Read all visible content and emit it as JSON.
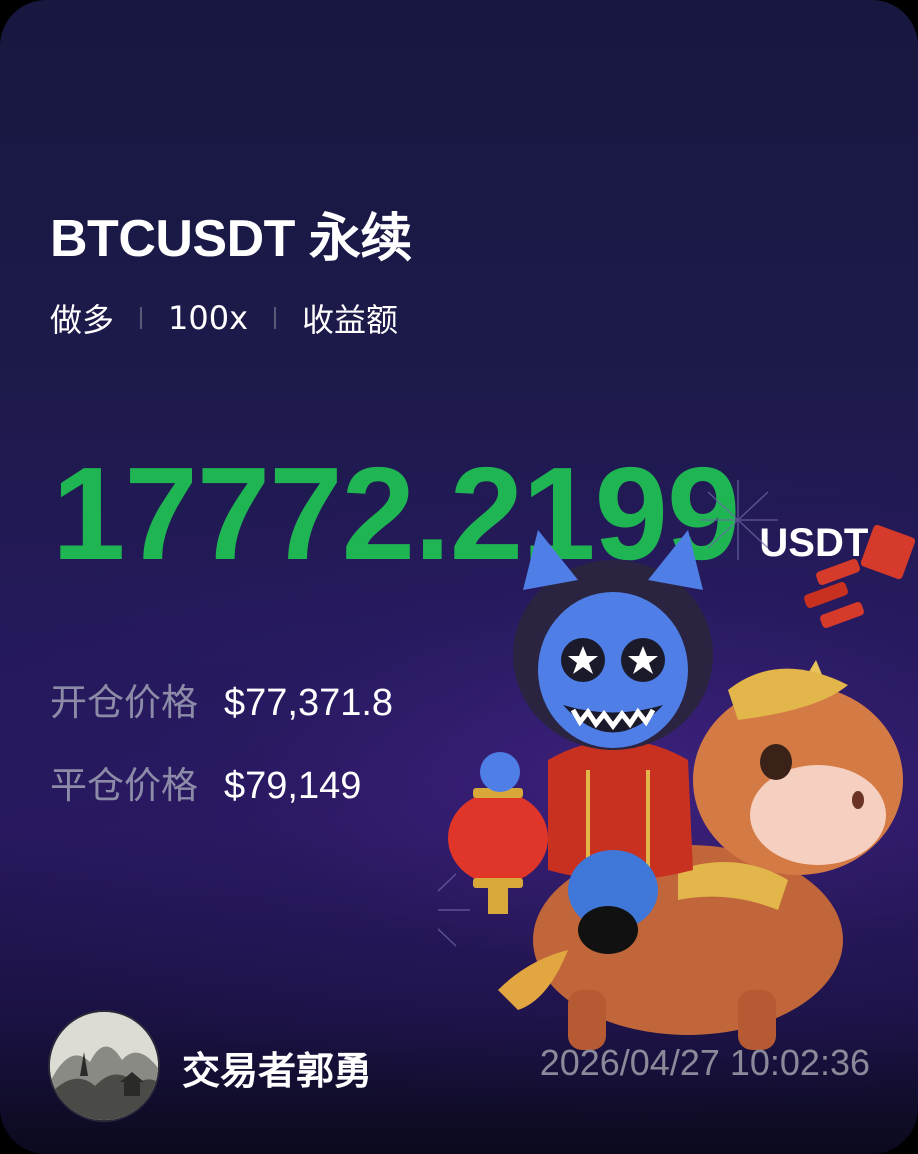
{
  "header": {
    "symbol": "BTCUSDT",
    "contract_type": "永续"
  },
  "position": {
    "side": "做多",
    "leverage": "100x",
    "metric_label": "收益额"
  },
  "pnl": {
    "value": "17772.2199",
    "unit": "USDT"
  },
  "prices": {
    "open_label": "开仓价格",
    "open_value": "$77,371.8",
    "close_label": "平仓价格",
    "close_value": "$79,149"
  },
  "footer": {
    "username": "交易者郭勇",
    "timestamp": "2026/04/27 10:02:36"
  },
  "colors": {
    "pnl_positive": "#1fb552",
    "background": "#1c1a4a"
  },
  "icons": {
    "avatar": "landscape-painting-avatar",
    "illustration": "mascot-riding-horse-illustration"
  }
}
